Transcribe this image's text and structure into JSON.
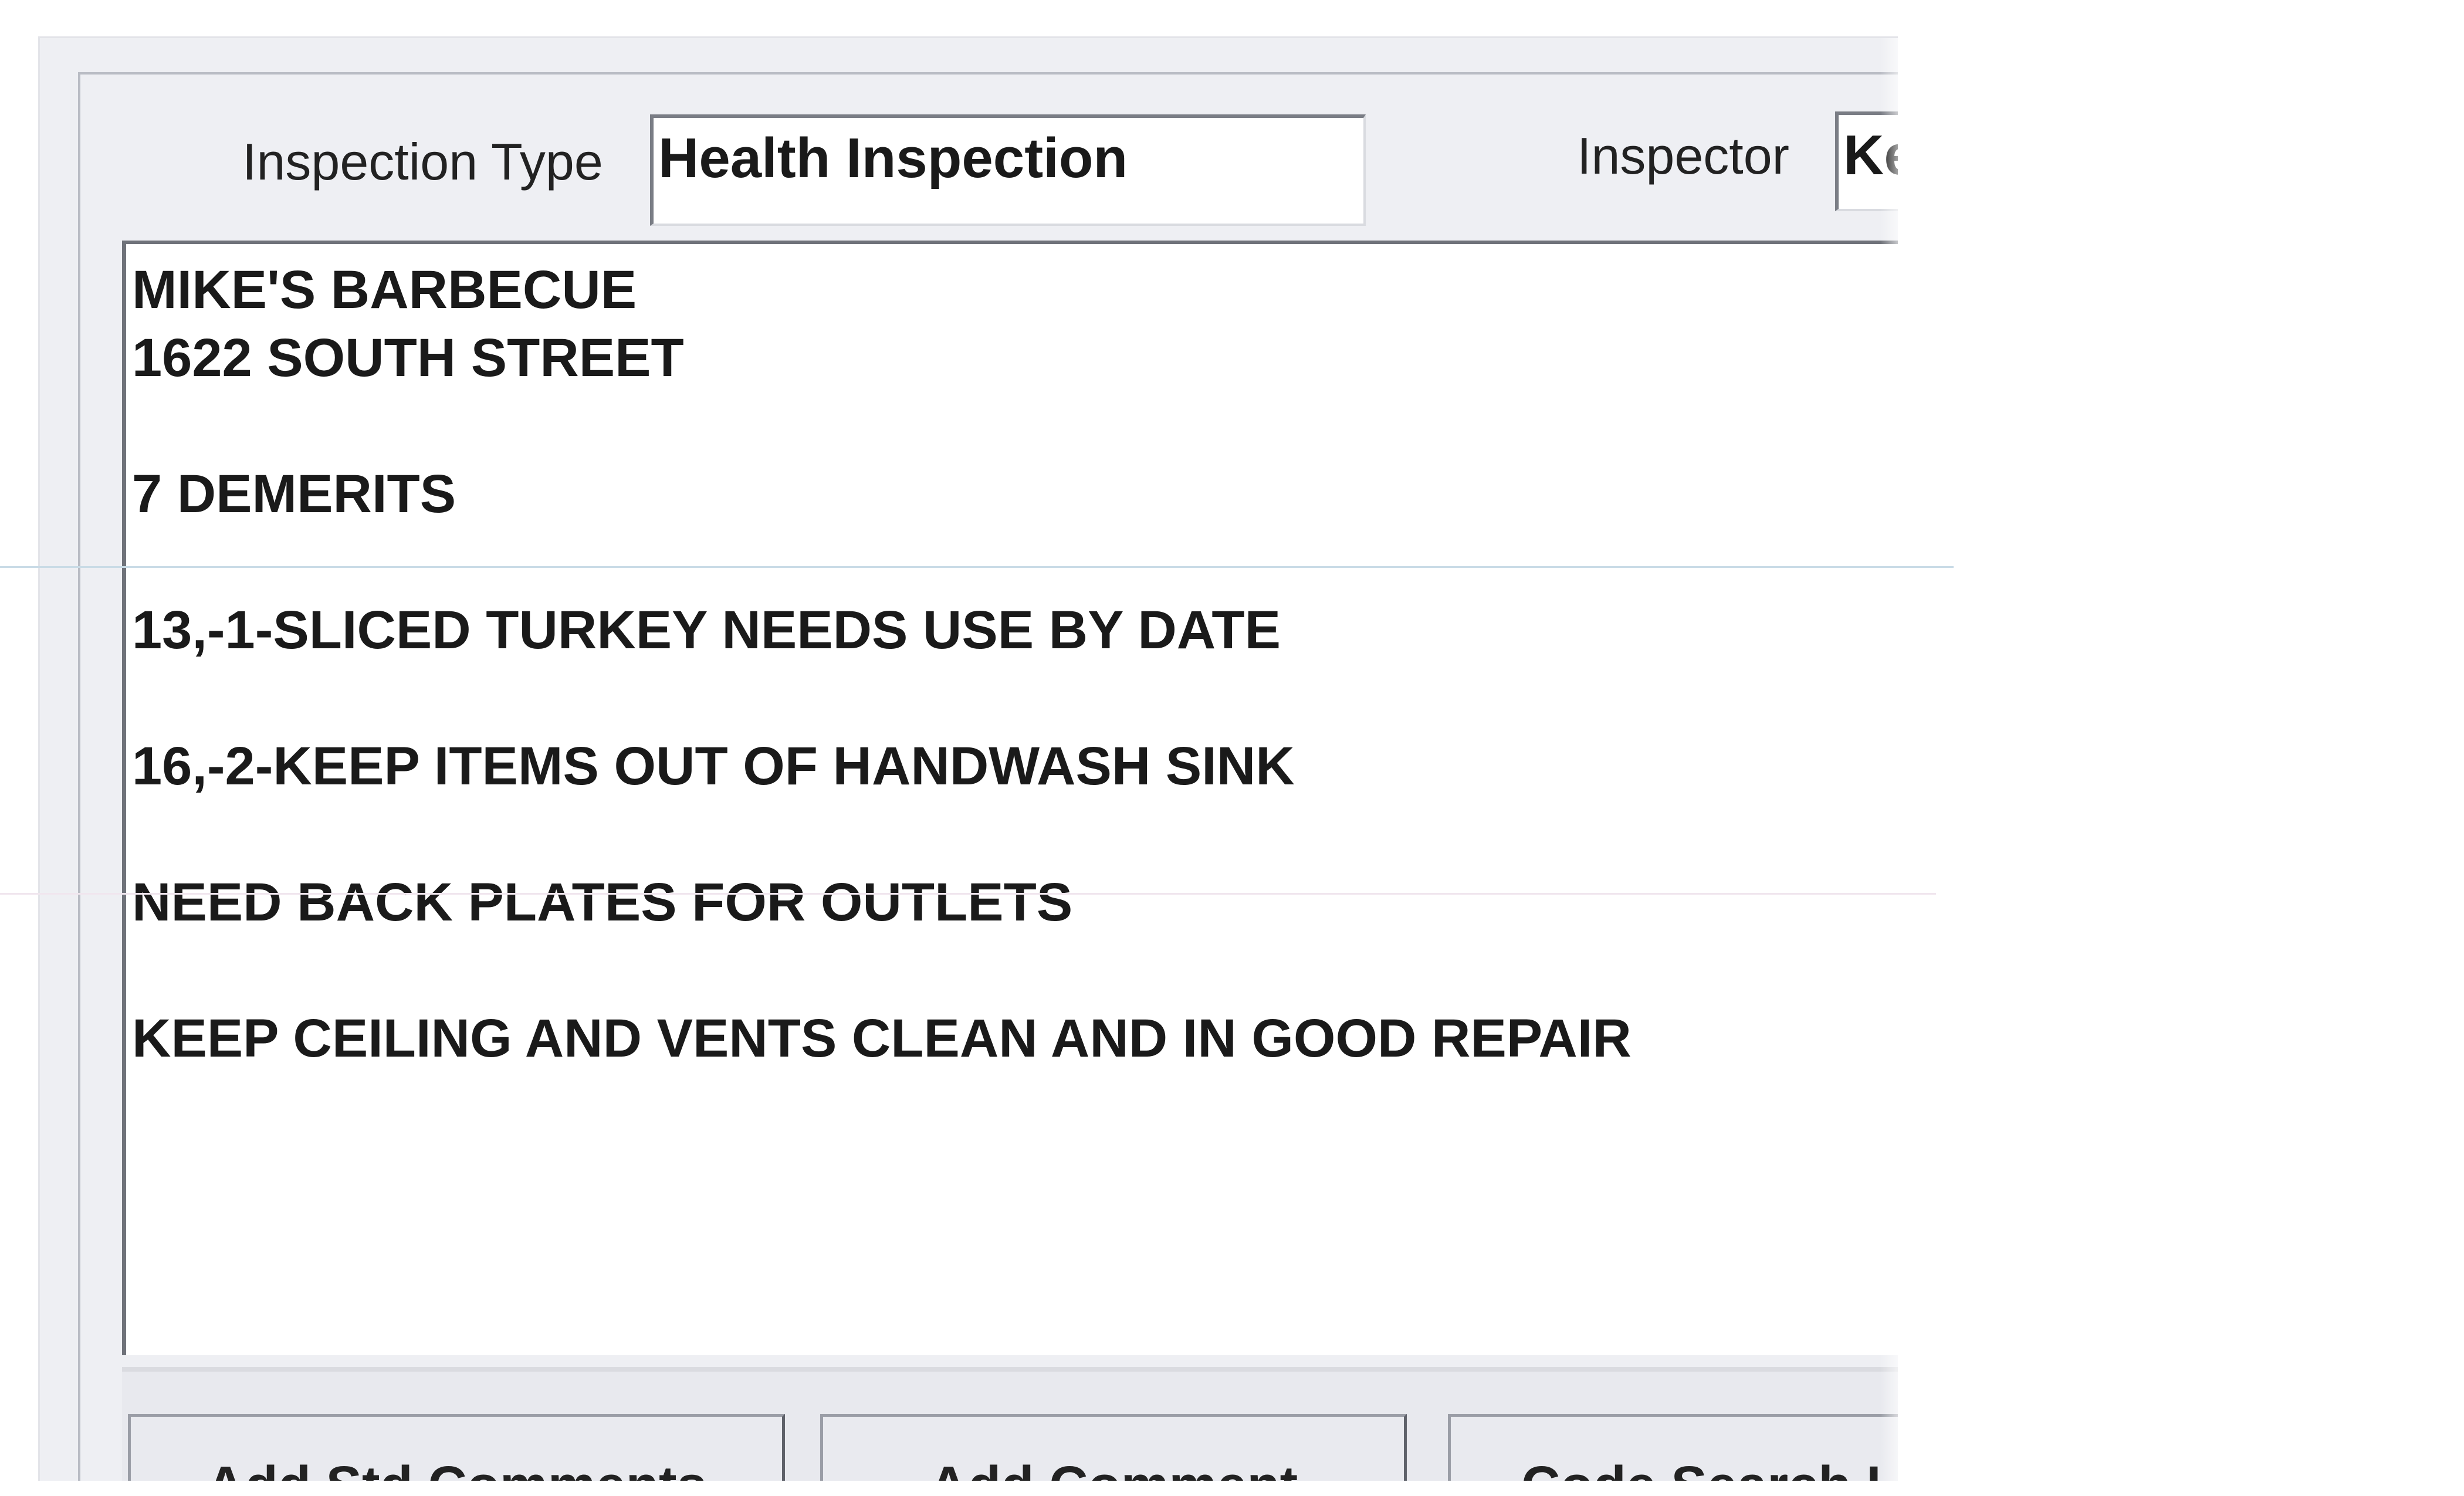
{
  "form": {
    "inspection_type_label": "Inspection Type",
    "inspection_type_value": "Health Inspection",
    "inspector_label": "Inspector",
    "inspector_value": "Ke"
  },
  "comments": {
    "lines": [
      "MIKE'S BARBECUE",
      "1622 SOUTH STREET",
      "",
      "7 DEMERITS",
      "",
      "13,-1-SLICED TURKEY NEEDS USE BY DATE",
      "",
      "16,-2-KEEP ITEMS OUT OF HANDWASH SINK",
      "",
      "NEED BACK PLATES FOR OUTLETS",
      "",
      "KEEP CEILING AND VENTS CLEAN AND IN GOOD REPAIR"
    ]
  },
  "buttons": {
    "add_std_comments_label": "Add Std Comments",
    "add_std_comments_mnemonic": "S",
    "add_comment_label": "Add Comment",
    "add_comment_mnemonic": "A",
    "code_search_label": "Code Search Li"
  }
}
